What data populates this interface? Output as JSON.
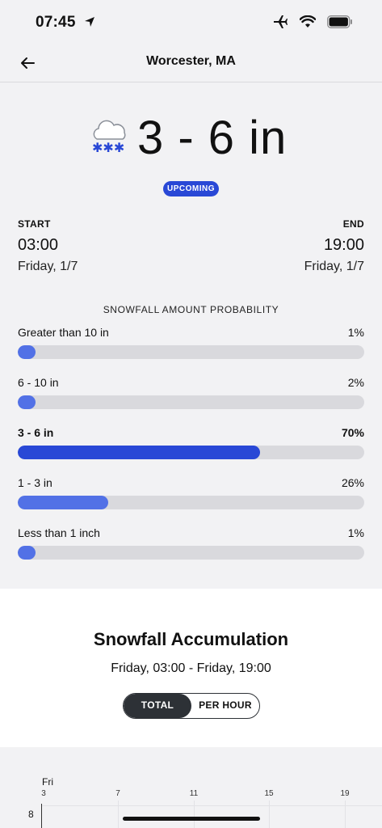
{
  "status": {
    "time": "07:45"
  },
  "nav": {
    "title": "Worcester, MA"
  },
  "hero": {
    "amount": "3 - 6 in",
    "badge": "UPCOMING"
  },
  "times": {
    "start_label": "START",
    "start_time": "03:00",
    "start_date": "Friday, 1/7",
    "end_label": "END",
    "end_time": "19:00",
    "end_date": "Friday, 1/7"
  },
  "probability": {
    "title": "SNOWFALL AMOUNT PROBABILITY",
    "rows": [
      {
        "label": "Greater than 10 in",
        "pct": "1%",
        "value": 1
      },
      {
        "label": "6 - 10 in",
        "pct": "2%",
        "value": 2
      },
      {
        "label": "3 - 6 in",
        "pct": "70%",
        "value": 70
      },
      {
        "label": "1 - 3 in",
        "pct": "26%",
        "value": 26
      },
      {
        "label": "Less than 1 inch",
        "pct": "1%",
        "value": 1
      }
    ]
  },
  "accumulation": {
    "title": "Snowfall Accumulation",
    "subtitle": "Friday, 03:00 - Friday, 19:00",
    "toggle_total": "TOTAL",
    "toggle_per_hour": "PER HOUR"
  },
  "chart": {
    "day": "Fri",
    "ticks": [
      "3",
      "7",
      "11",
      "15",
      "19"
    ],
    "y_top": "8"
  },
  "colors": {
    "accent": "#2948d6",
    "accent_light": "#5271e6",
    "track": "#d9d9dd",
    "toggle_dark": "#2d3136"
  }
}
